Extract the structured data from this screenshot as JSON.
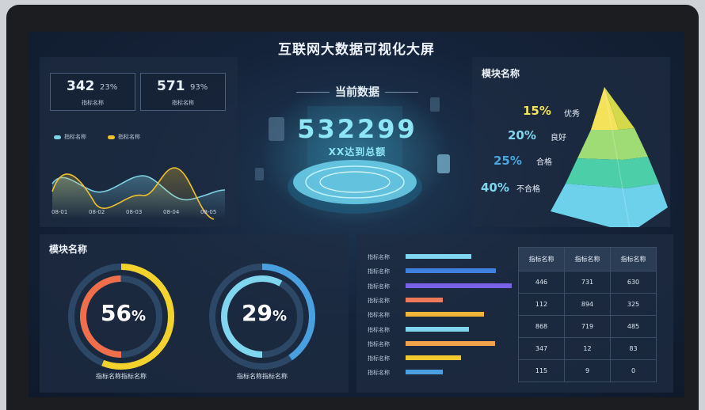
{
  "title": "互联网大数据可视化大屏",
  "stats": [
    {
      "value": "342",
      "percent": "23%",
      "label": "指标名称"
    },
    {
      "value": "571",
      "percent": "93%",
      "label": "指标名称"
    }
  ],
  "line_chart": {
    "legend": [
      "指标名称",
      "指标名称"
    ],
    "x_ticks": [
      "08-01",
      "08-02",
      "08-03",
      "08-04",
      "08-05"
    ],
    "colors": [
      "#7fd3e6",
      "#f0c02e"
    ]
  },
  "center": {
    "heading": "当前数据",
    "value": "532299",
    "subtitle": "XX达到总额"
  },
  "pyramid": {
    "title": "模块名称",
    "levels": [
      {
        "percent": "15%",
        "label": "优秀",
        "color": "#f3e25a"
      },
      {
        "percent": "20%",
        "label": "良好",
        "color": "#9fdc76"
      },
      {
        "percent": "25%",
        "label": "合格",
        "color": "#4ccfa8"
      },
      {
        "percent": "40%",
        "label": "不合格",
        "color": "#6ed1ec"
      }
    ]
  },
  "donuts": {
    "title": "模块名称",
    "items": [
      {
        "value": "56",
        "unit": "%",
        "fraction": 0.56,
        "caption": "指标名称指标名称",
        "color": "#f4d22d",
        "inner_color": "#ef6f4d"
      },
      {
        "value": "29",
        "unit": "%",
        "fraction": 0.29,
        "caption": "指标名称指标名称",
        "color": "#4a9fe0",
        "inner_color": "#7fd6ee"
      }
    ]
  },
  "bars": {
    "labels": [
      "指标名称",
      "指标名称",
      "指标名称",
      "指标名称",
      "指标名称",
      "指标名称",
      "指标名称",
      "指标名称",
      "指标名称"
    ],
    "values": [
      0.62,
      0.85,
      1.0,
      0.35,
      0.74,
      0.6,
      0.84,
      0.52,
      0.35
    ],
    "colors": [
      "#7fd6ee",
      "#3f7fe0",
      "#7a62e8",
      "#ef7a5a",
      "#f2b53a",
      "#7fd6ee",
      "#f2a24a",
      "#f2c92e",
      "#4a9fe0"
    ]
  },
  "table": {
    "headers": [
      "指标名称",
      "指标名称",
      "指标名称"
    ],
    "rows": [
      [
        "446",
        "731",
        "630"
      ],
      [
        "112",
        "894",
        "325"
      ],
      [
        "868",
        "719",
        "485"
      ],
      [
        "347",
        "12",
        "83"
      ],
      [
        "115",
        "9",
        "0"
      ]
    ]
  }
}
